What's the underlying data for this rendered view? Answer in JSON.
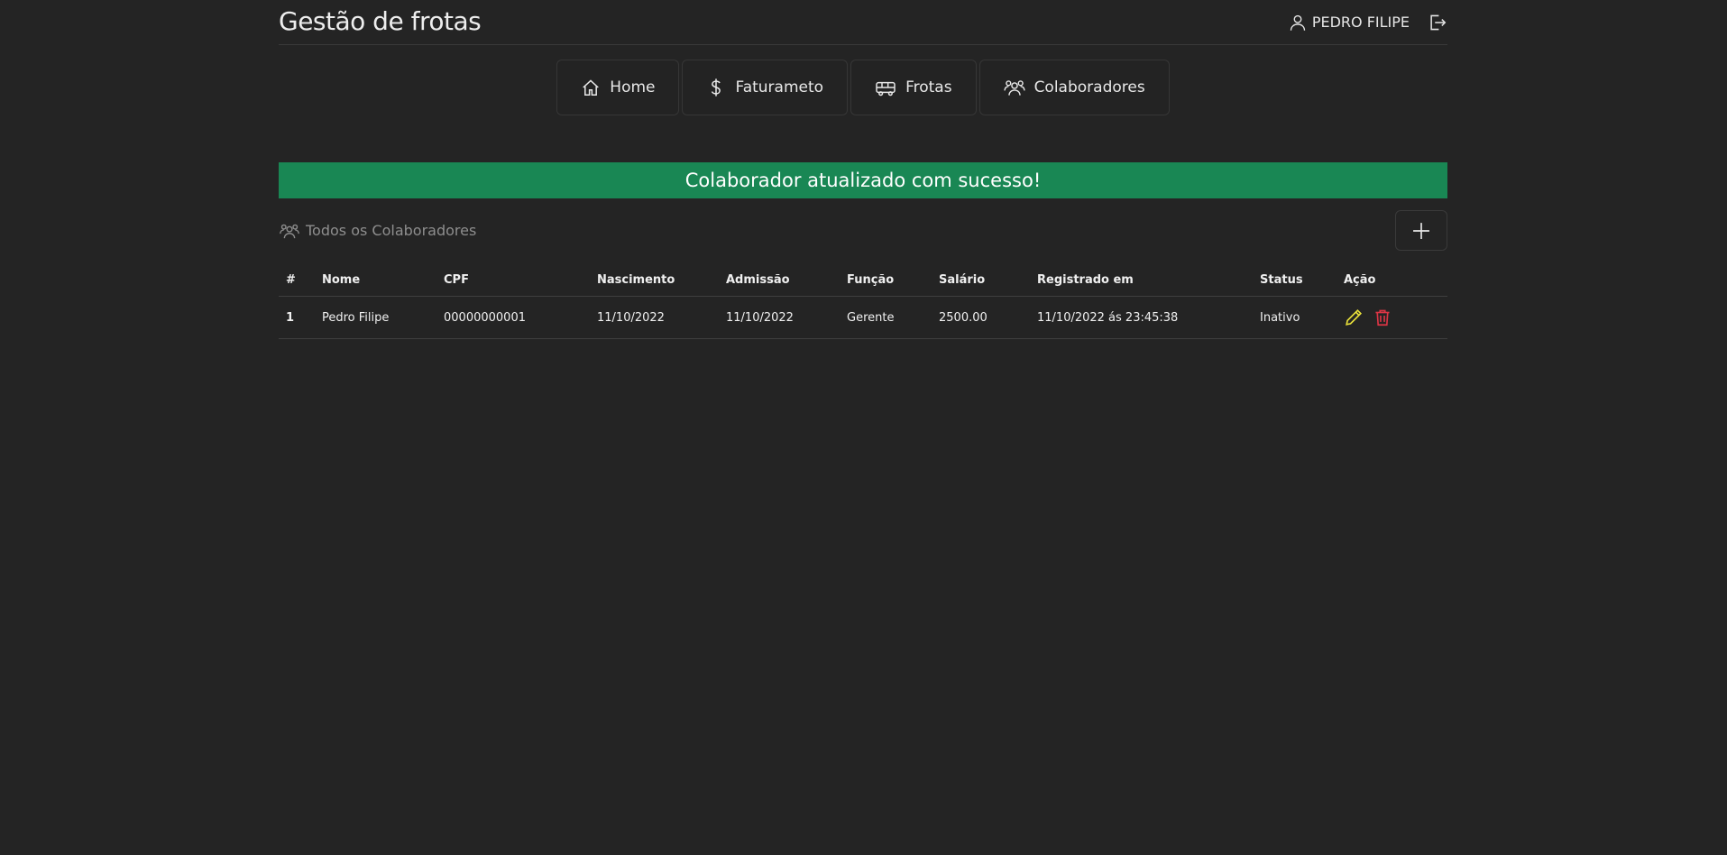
{
  "header": {
    "title": "Gestão de frotas",
    "user_name": "PEDRO FILIPE",
    "user_icon": "person-icon",
    "logout_icon": "logout-icon"
  },
  "nav": {
    "items": [
      {
        "label": "Home",
        "icon": "house-icon"
      },
      {
        "label": "Faturameto",
        "icon": "dollar-icon"
      },
      {
        "label": "Frotas",
        "icon": "bus-icon"
      },
      {
        "label": "Colaboradores",
        "icon": "people-icon"
      }
    ]
  },
  "alert": {
    "message": "Colaborador atualizado com sucesso!",
    "color": "#198754"
  },
  "section": {
    "title": "Todos os Colaboradores",
    "add_icon": "plus-icon"
  },
  "table": {
    "columns": [
      "#",
      "Nome",
      "CPF",
      "Nascimento",
      "Admissão",
      "Função",
      "Salário",
      "Registrado em",
      "Status",
      "Ação"
    ],
    "rows": [
      {
        "index": "1",
        "nome": "Pedro Filipe",
        "cpf": "00000000001",
        "nascimento": "11/10/2022",
        "admissao": "11/10/2022",
        "funcao": "Gerente",
        "salario": "2500.00",
        "registrado": "11/10/2022 ás 23:45:38",
        "status": "Inativo"
      }
    ]
  },
  "colors": {
    "edit": "#e8e03a",
    "delete": "#dc3545",
    "background": "#242424"
  }
}
